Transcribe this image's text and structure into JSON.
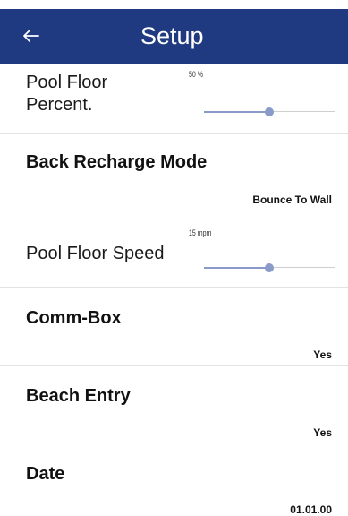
{
  "header": {
    "title": "Setup",
    "back_icon": "arrow-left-icon",
    "background": "#1f3a80"
  },
  "settings": {
    "pool_floor_percent": {
      "label_line1": "Pool Floor",
      "label_line2": "Percent.",
      "value_label": "50 %",
      "level": 0.5
    },
    "back_recharge_mode": {
      "label": "Back Recharge Mode",
      "value": "Bounce To Wall"
    },
    "pool_floor_speed": {
      "label": "Pool Floor Speed",
      "value_label": "15 mpm",
      "level": 0.5
    },
    "comm_box": {
      "label": "Comm-Box",
      "value": "Yes"
    },
    "beach_entry": {
      "label": "Beach Entry",
      "value": "Yes"
    },
    "date": {
      "label": "Date",
      "value": "01.01.00"
    }
  },
  "colors": {
    "accent": "#1f3a80",
    "slider": "#8b9bc9"
  }
}
